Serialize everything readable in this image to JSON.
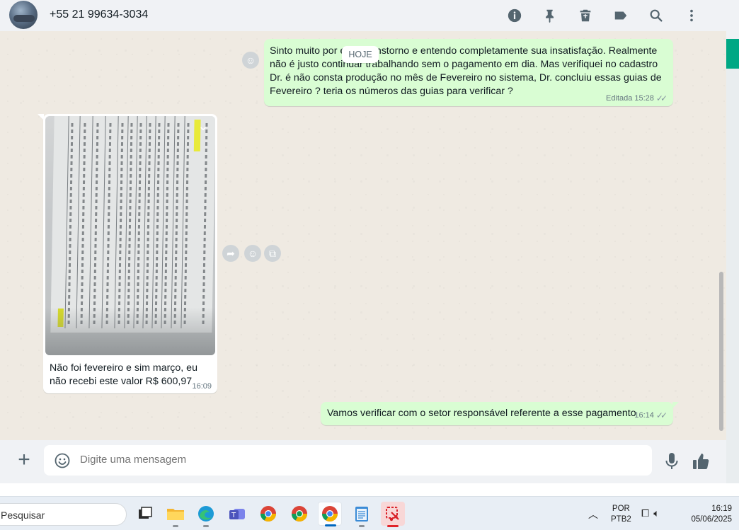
{
  "header": {
    "contact_name": "+55 21 99634-3034",
    "icons": [
      "info-icon",
      "pin-icon",
      "delete-icon",
      "label-icon",
      "search-icon",
      "menu-icon"
    ]
  },
  "date_separator": "HOJE",
  "messages": [
    {
      "direction": "outgoing",
      "text": "Sinto muito por esse transtorno e entendo completamente sua insatisfação. Realmente não é justo continuar trabalhando sem o pagamento em dia. Mas verifiquei no cadastro Dr. é não consta produção no mês de Fevereiro no sistema, Dr. concluiu essas guias de Fevereiro ? teria os números das guias para verificar ?",
      "status": "Editada",
      "time": "15:28"
    },
    {
      "direction": "incoming",
      "type": "image",
      "caption": "Não foi fevereiro e sim março, eu não recebi este valor R$ 600,97",
      "time": "16:09"
    },
    {
      "direction": "outgoing",
      "text": "Vamos verificar com o setor responsável referente a esse pagamento",
      "time": "16:14"
    }
  ],
  "composer": {
    "placeholder": "Digite uma mensagem"
  },
  "taskbar": {
    "search_placeholder": "Pesquisar",
    "language_line1": "POR",
    "language_line2": "PTB2",
    "time": "16:19",
    "date": "05/06/2025"
  },
  "colors": {
    "outgoing_bubble": "#d9fdd3",
    "incoming_bubble": "#ffffff",
    "accent": "#00a884",
    "chat_background": "#efeae2"
  }
}
